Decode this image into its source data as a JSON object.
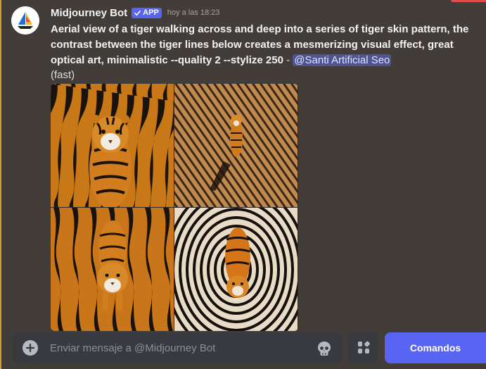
{
  "message": {
    "author": "Midjourney Bot",
    "badge": "APP",
    "timestamp": "hoy a las 18:23",
    "prompt": "Aerial view of a tiger walking across and deep into a series of tiger skin pattern, the contrast between the tiger lines below creates a mesmerizing visual effect, great optical art, minimalistic --quality 2 --stylize 250",
    "separator": " - ",
    "mention": "@Santi Artificial Seo",
    "speed": "(fast)"
  },
  "composer": {
    "placeholder": "Enviar mensaje a @Midjourney Bot",
    "commands_label": "Comandos"
  },
  "colors": {
    "background": "#423d38",
    "accent": "#5865f2",
    "mention_bg": "#4f5391",
    "left_bar": "#c9a227"
  },
  "icons": [
    "sailboat-avatar-icon",
    "verified-check-icon",
    "plus-circle-icon",
    "skull-emoji-icon",
    "apps-grid-icon"
  ]
}
